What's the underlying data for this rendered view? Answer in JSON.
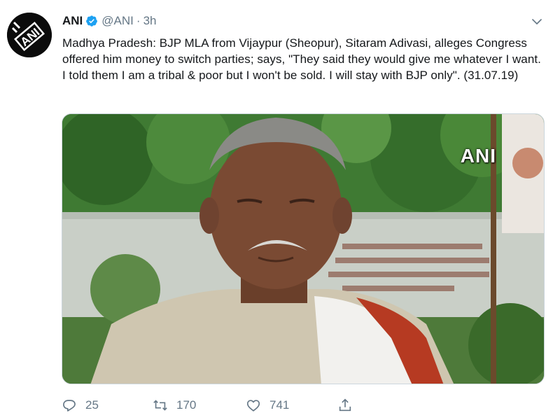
{
  "tweet": {
    "author_name": "ANI",
    "handle": "@ANI",
    "separator": "·",
    "time": "3h",
    "avatar_text": "ANI",
    "text": "Madhya Pradesh: BJP MLA from Vijaypur (Sheopur), Sitaram Adivasi, alleges Congress offered him money to switch parties; says, \"They said they would give me whatever I want. I told them I am a tribal & poor but I won't be sold. I will stay with BJP only\". (31.07.19)",
    "media": {
      "watermark": "ANI"
    },
    "actions": {
      "reply_count": "25",
      "retweet_count": "170",
      "like_count": "741"
    }
  },
  "colors": {
    "text": "#14171a",
    "secondary": "#657786",
    "verified": "#1da1f2"
  },
  "icons": {
    "verified": "verified-badge-icon",
    "caret": "chevron-down-icon",
    "reply": "reply-icon",
    "retweet": "retweet-icon",
    "like": "heart-icon",
    "share": "share-icon"
  }
}
